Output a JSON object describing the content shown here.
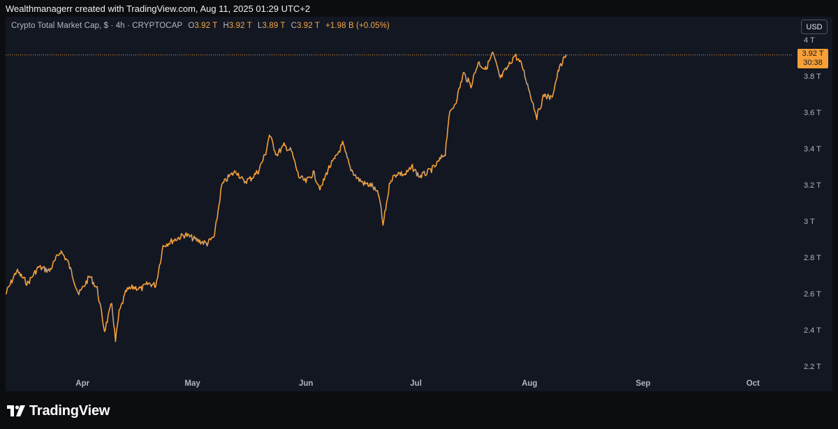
{
  "header": {
    "credit": "Wealthmanagerr created with TradingView.com, Aug 11, 2025 01:29 UTC+2"
  },
  "legend": {
    "symbol": "Crypto Total Market Cap, $ · 4h · CRYPTOCAP",
    "open_label": "O",
    "open": "3.92 T",
    "high_label": "H",
    "high": "3.92 T",
    "low_label": "L",
    "low": "3.89 T",
    "close_label": "C",
    "close": "3.92 T",
    "change": "+1.98 B (+0.05%)"
  },
  "currency_button": "USD",
  "price_tag": {
    "price": "3.92 T",
    "countdown": "30:38"
  },
  "footer": {
    "brand": "TradingView"
  },
  "colors": {
    "background": "#131722",
    "line": "#f7a037",
    "line_muted": "#9aa3b5",
    "price_line": "#f7a037"
  },
  "chart_data": {
    "type": "line",
    "title": "Crypto Total Market Cap, $ · 4h · CRYPTOCAP",
    "y_ticks": [
      "4 T",
      "3.8 T",
      "3.6 T",
      "3.4 T",
      "3.2 T",
      "3 T",
      "2.8 T",
      "2.6 T",
      "2.4 T",
      "2.2 T"
    ],
    "y_tick_values": [
      4.0,
      3.8,
      3.6,
      3.4,
      3.2,
      3.0,
      2.8,
      2.6,
      2.4,
      2.2
    ],
    "x_ticks": [
      "Apr",
      "May",
      "Jun",
      "Jul",
      "Aug",
      "Sep",
      "Oct"
    ],
    "x_tick_dates": [
      "2025-04-01",
      "2025-05-01",
      "2025-06-01",
      "2025-07-01",
      "2025-08-01",
      "2025-09-01",
      "2025-10-01"
    ],
    "ylim": [
      2.1,
      4.05
    ],
    "xlim": [
      "2025-03-11",
      "2025-10-12"
    ],
    "last_price": 3.92,
    "series": [
      {
        "values_unit": "T USD",
        "points": [
          [
            "2025-03-11",
            2.6
          ],
          [
            "2025-03-14",
            2.73
          ],
          [
            "2025-03-17",
            2.66
          ],
          [
            "2025-03-20",
            2.75
          ],
          [
            "2025-03-23",
            2.73
          ],
          [
            "2025-03-26",
            2.84
          ],
          [
            "2025-03-28",
            2.78
          ],
          [
            "2025-03-31",
            2.6
          ],
          [
            "2025-04-03",
            2.7
          ],
          [
            "2025-04-05",
            2.63
          ],
          [
            "2025-04-07",
            2.4
          ],
          [
            "2025-04-09",
            2.55
          ],
          [
            "2025-04-10",
            2.34
          ],
          [
            "2025-04-11",
            2.5
          ],
          [
            "2025-04-13",
            2.62
          ],
          [
            "2025-04-15",
            2.64
          ],
          [
            "2025-04-17",
            2.63
          ],
          [
            "2025-04-19",
            2.66
          ],
          [
            "2025-04-21",
            2.65
          ],
          [
            "2025-04-23",
            2.87
          ],
          [
            "2025-04-26",
            2.9
          ],
          [
            "2025-04-29",
            2.93
          ],
          [
            "2025-05-02",
            2.9
          ],
          [
            "2025-05-05",
            2.88
          ],
          [
            "2025-05-07",
            2.92
          ],
          [
            "2025-05-09",
            3.2
          ],
          [
            "2025-05-11",
            3.25
          ],
          [
            "2025-05-13",
            3.28
          ],
          [
            "2025-05-15",
            3.22
          ],
          [
            "2025-05-17",
            3.24
          ],
          [
            "2025-05-19",
            3.28
          ],
          [
            "2025-05-21",
            3.38
          ],
          [
            "2025-05-22",
            3.48
          ],
          [
            "2025-05-24",
            3.37
          ],
          [
            "2025-05-26",
            3.42
          ],
          [
            "2025-05-28",
            3.39
          ],
          [
            "2025-05-30",
            3.25
          ],
          [
            "2025-06-01",
            3.22
          ],
          [
            "2025-06-03",
            3.27
          ],
          [
            "2025-06-05",
            3.18
          ],
          [
            "2025-06-07",
            3.29
          ],
          [
            "2025-06-09",
            3.35
          ],
          [
            "2025-06-11",
            3.43
          ],
          [
            "2025-06-13",
            3.3
          ],
          [
            "2025-06-15",
            3.24
          ],
          [
            "2025-06-17",
            3.21
          ],
          [
            "2025-06-19",
            3.2
          ],
          [
            "2025-06-21",
            3.14
          ],
          [
            "2025-06-22",
            2.98
          ],
          [
            "2025-06-24",
            3.23
          ],
          [
            "2025-06-26",
            3.27
          ],
          [
            "2025-06-28",
            3.26
          ],
          [
            "2025-06-30",
            3.3
          ],
          [
            "2025-07-02",
            3.25
          ],
          [
            "2025-07-04",
            3.27
          ],
          [
            "2025-07-06",
            3.3
          ],
          [
            "2025-07-09",
            3.38
          ],
          [
            "2025-07-10",
            3.58
          ],
          [
            "2025-07-12",
            3.67
          ],
          [
            "2025-07-14",
            3.82
          ],
          [
            "2025-07-16",
            3.75
          ],
          [
            "2025-07-18",
            3.88
          ],
          [
            "2025-07-20",
            3.84
          ],
          [
            "2025-07-22",
            3.93
          ],
          [
            "2025-07-24",
            3.79
          ],
          [
            "2025-07-26",
            3.85
          ],
          [
            "2025-07-28",
            3.92
          ],
          [
            "2025-07-30",
            3.86
          ],
          [
            "2025-08-01",
            3.72
          ],
          [
            "2025-08-03",
            3.58
          ],
          [
            "2025-08-05",
            3.7
          ],
          [
            "2025-08-07",
            3.68
          ],
          [
            "2025-08-09",
            3.84
          ],
          [
            "2025-08-11",
            3.92
          ]
        ]
      }
    ]
  }
}
